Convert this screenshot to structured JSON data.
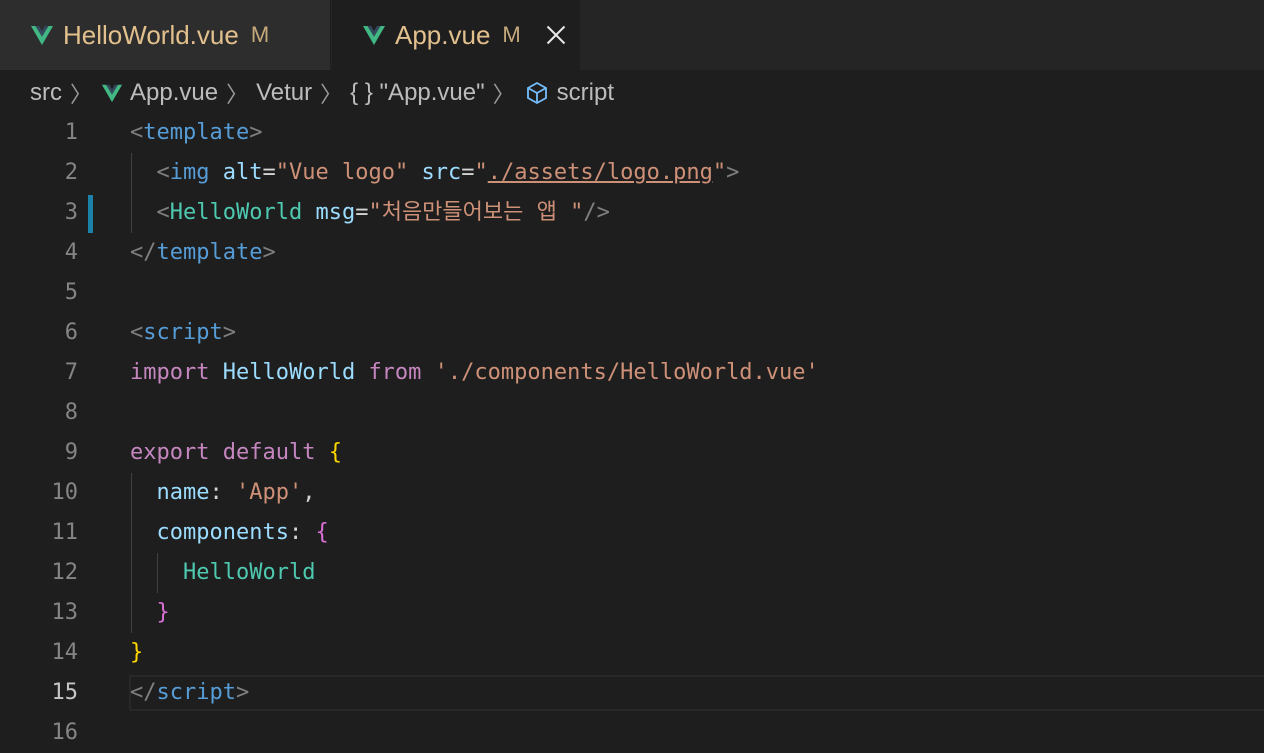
{
  "tabs": [
    {
      "label": "HelloWorld.vue",
      "status": "M",
      "active": false
    },
    {
      "label": "App.vue",
      "status": "M",
      "active": true
    }
  ],
  "breadcrumb": {
    "items": [
      "src",
      "App.vue",
      "Vetur",
      "{ } \"App.vue\"",
      "script"
    ],
    "icons": [
      "none",
      "vue-icon",
      "none",
      "none",
      "cube-icon"
    ]
  },
  "editor": {
    "current_line": 15,
    "line_numbers": [
      "1",
      "2",
      "3",
      "4",
      "5",
      "6",
      "7",
      "8",
      "9",
      "10",
      "11",
      "12",
      "13",
      "14",
      "15",
      "16"
    ],
    "tokens": {
      "l1_open": "<",
      "l1_tag": "template",
      "l1_close": ">",
      "l2_indent": "  ",
      "l2_open": "<",
      "l2_tag": "img",
      "l2_sp1": " ",
      "l2_attr1": "alt",
      "l2_eq1": "=",
      "l2_val1": "\"Vue logo\"",
      "l2_sp2": " ",
      "l2_attr2": "src",
      "l2_eq2": "=",
      "l2_q1": "\"",
      "l2_url": "./assets/logo.png",
      "l2_q2": "\"",
      "l2_close": ">",
      "l3_indent": "  ",
      "l3_open": "<",
      "l3_tag": "HelloWorld",
      "l3_sp": " ",
      "l3_attr": "msg",
      "l3_eq": "=",
      "l3_val": "\"처음만들어보는 앱 \"",
      "l3_close": "/>",
      "l4_open": "</",
      "l4_tag": "template",
      "l4_close": ">",
      "l6_open": "<",
      "l6_tag": "script",
      "l6_close": ">",
      "l7_kw1": "import",
      "l7_var": "HelloWorld",
      "l7_kw2": "from",
      "l7_str": "'./components/HelloWorld.vue'",
      "l9_kw1": "export",
      "l9_kw2": "default",
      "l9_brace": "{",
      "l10_indent": "  ",
      "l10_key": "name",
      "l10_colon": ": ",
      "l10_val": "'App'",
      "l10_comma": ",",
      "l11_indent": "  ",
      "l11_key": "components",
      "l11_colon": ": ",
      "l11_brace": "{",
      "l12_indent": "    ",
      "l12_val": "HelloWorld",
      "l13_indent": "  ",
      "l13_brace": "}",
      "l14_brace": "}",
      "l15_open": "</",
      "l15_tag": "script",
      "l15_close": ">"
    }
  },
  "colors": {
    "background": "#1e1e1e",
    "tab_modified": "#e2c08d",
    "vue_green": "#41b883",
    "tag": "#569cd6",
    "component": "#4ec9b0",
    "attribute": "#9cdcfe",
    "string": "#ce9178",
    "keyword": "#c586c0",
    "bracket_gold": "#ffd700",
    "bracket_pink": "#da70d6"
  }
}
